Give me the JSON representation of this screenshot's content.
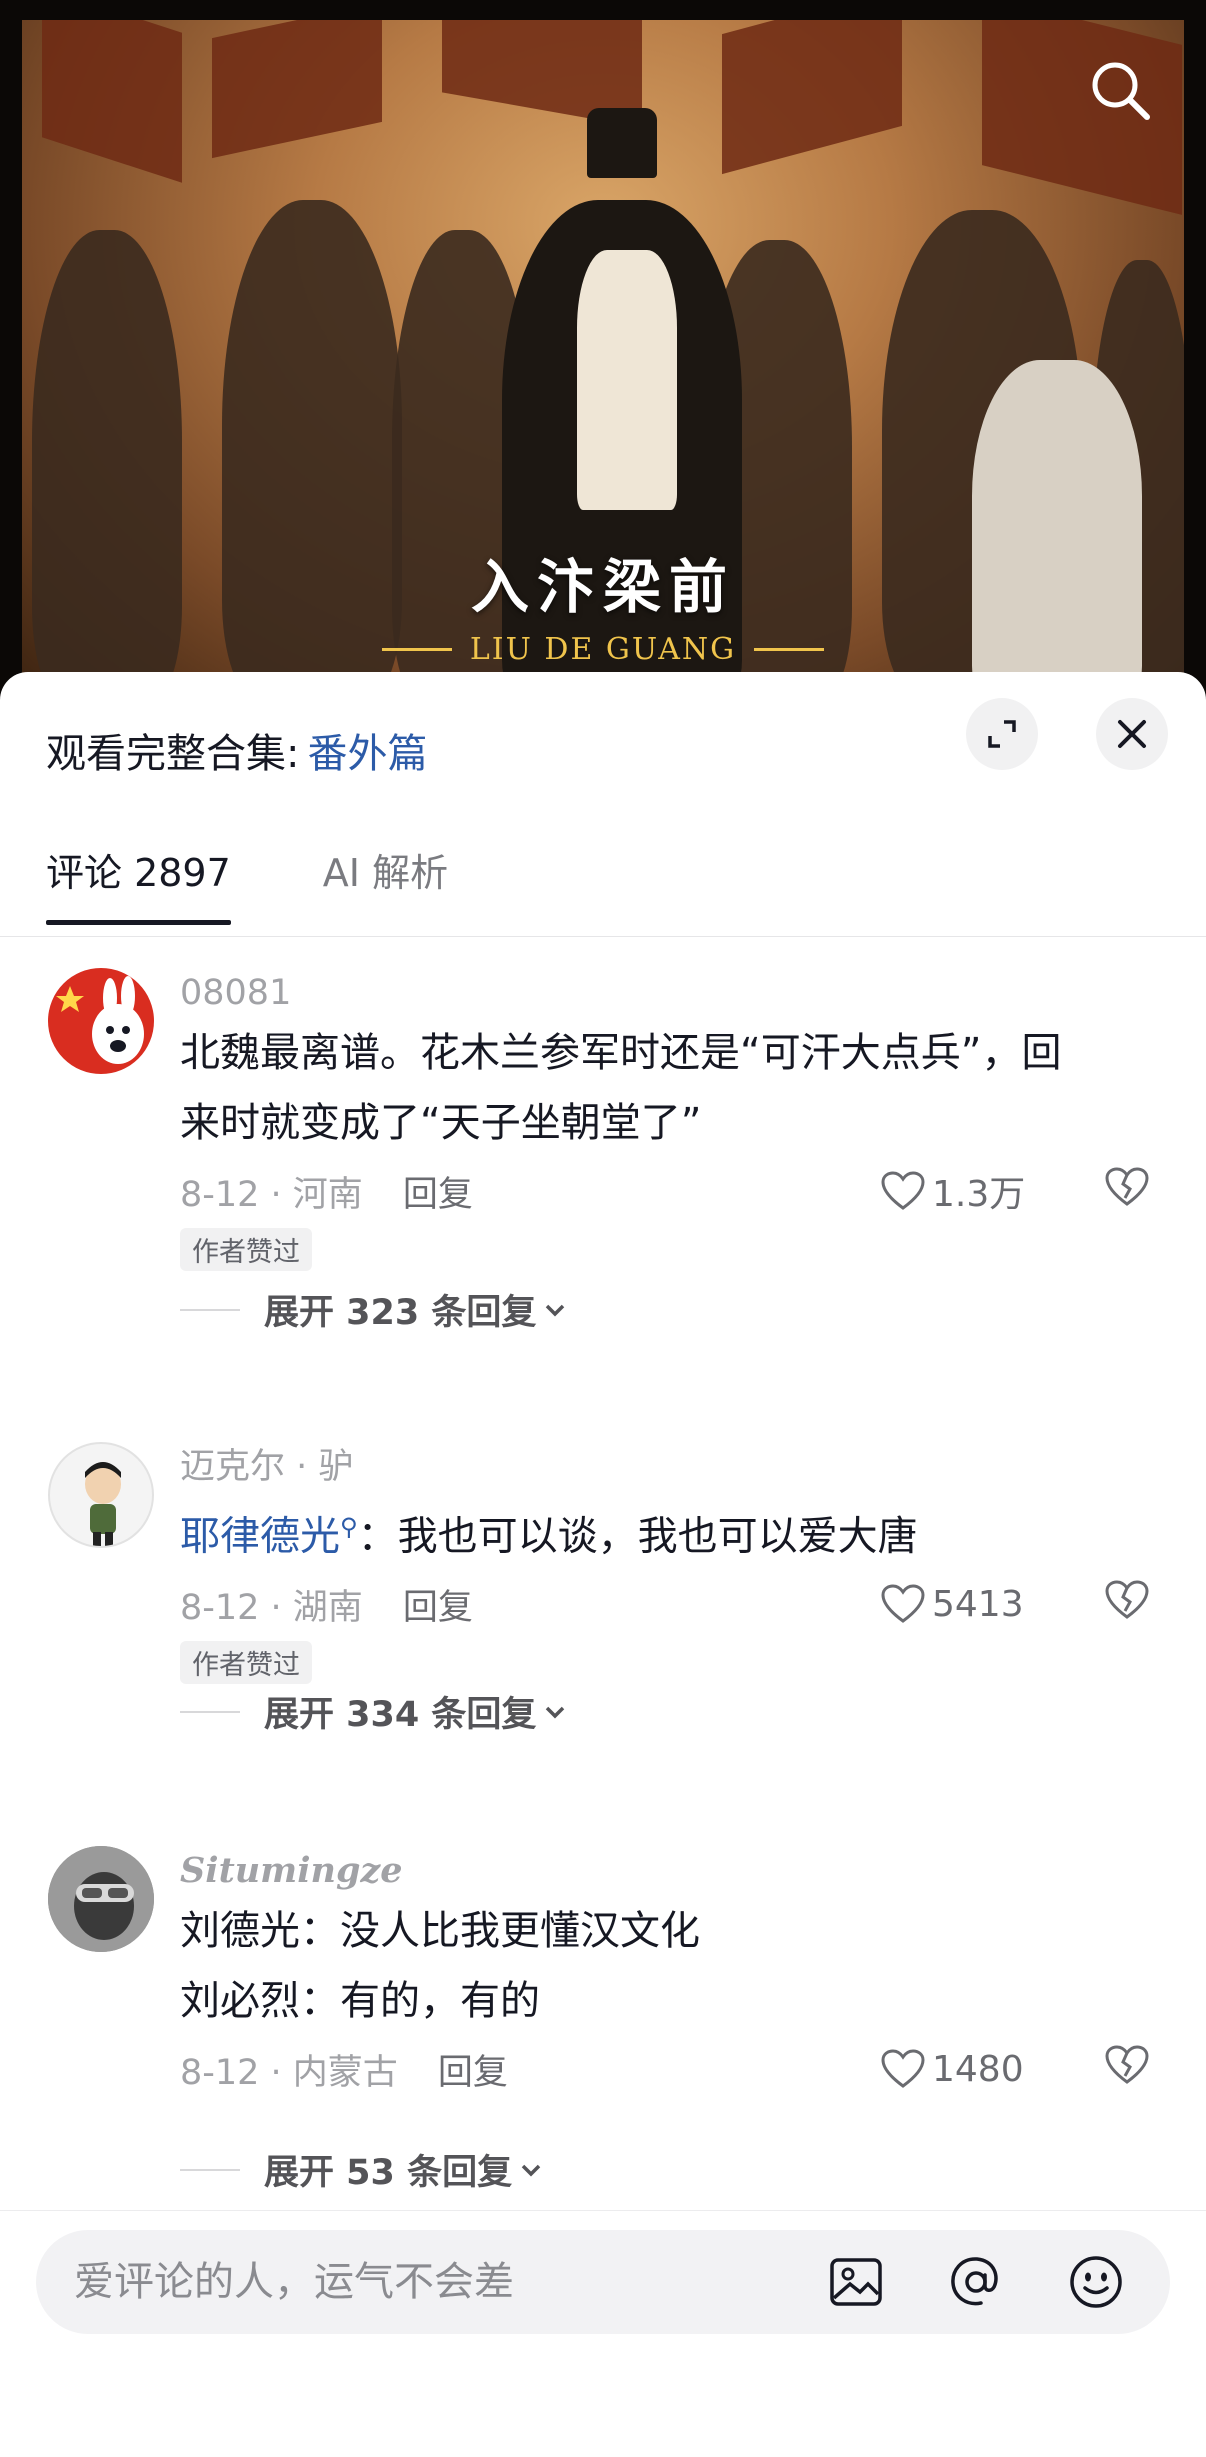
{
  "video": {
    "title": "入汴梁前",
    "subtitle": "LIU DE GUANG"
  },
  "sheet": {
    "collection_label": "观看完整合集:",
    "collection_link": "番外篇"
  },
  "tabs": [
    {
      "label": "评论 2897"
    },
    {
      "label": "AI 解析"
    }
  ],
  "comments": [
    {
      "username": "08081",
      "text_line1": "北魏最离谱。花木兰参军时还是“可汗大点兵”，回",
      "text_line2": "来时就变成了“天子坐朝堂了”",
      "date_location": "8-12 · 河南",
      "reply": "回复",
      "likes": "1.3万",
      "badge": "作者赞过",
      "expand": "展开 323 条回复"
    },
    {
      "username": "迈克尔 · 驴",
      "mention": "耶律德光",
      "text": "：我也可以谈，我也可以爱大唐",
      "date_location": "8-12 · 湖南",
      "reply": "回复",
      "likes": "5413",
      "badge": "作者赞过",
      "expand": "展开 334 条回复"
    },
    {
      "username": "Situmingze",
      "text_line1": "刘德光：没人比我更懂汉文化",
      "text_line2": "刘必烈：有的，有的",
      "date_location": "8-12 · 内蒙古",
      "reply": "回复",
      "likes": "1480",
      "expand": "展开 53 条回复"
    }
  ],
  "input": {
    "placeholder": "爱评论的人，运气不会差"
  },
  "icons": {
    "search": "search-icon",
    "expand": "expand-icon",
    "close": "close-icon",
    "like": "heart-icon",
    "dislike": "broken-heart-icon",
    "chevron": "chevron-down-icon",
    "image": "image-icon",
    "at": "at-icon",
    "emoji": "emoji-icon"
  },
  "colors": {
    "link": "#2c5ba8",
    "accent_gold": "#f0c44c",
    "text_primary": "#161823",
    "text_secondary": "#a1a2a6"
  }
}
